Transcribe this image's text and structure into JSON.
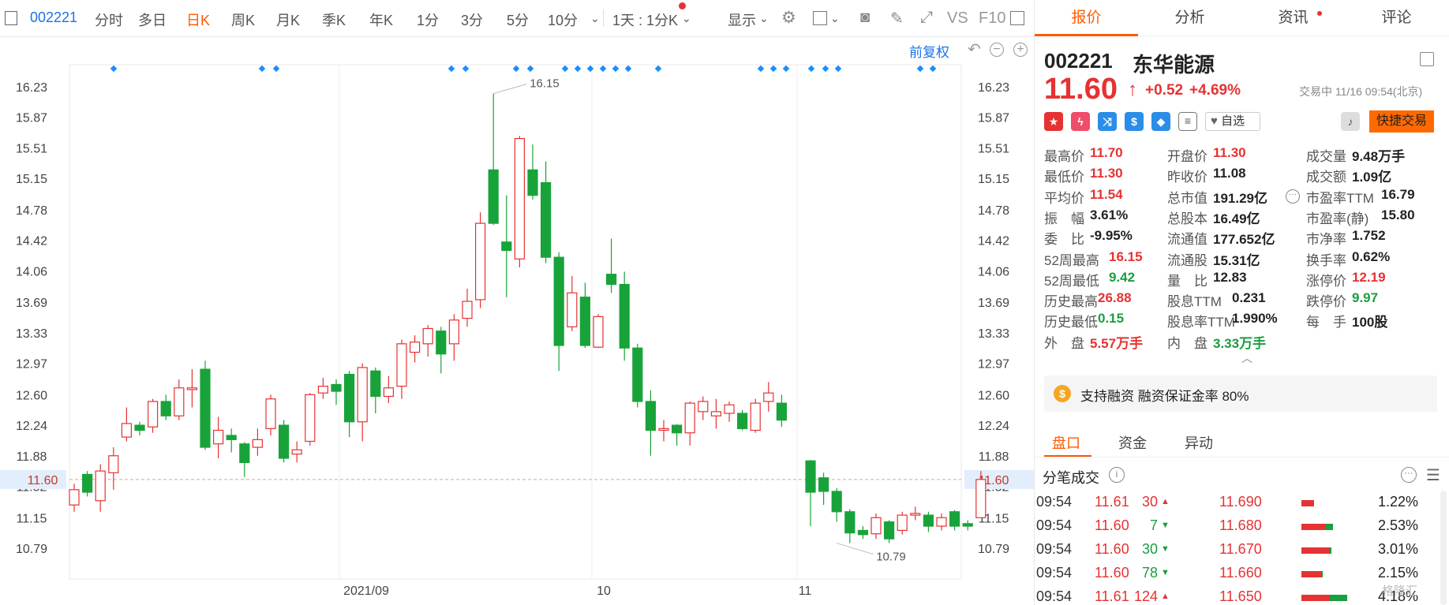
{
  "toolbar": {
    "code": "002221",
    "periods": [
      "分时",
      "多日",
      "日K",
      "周K",
      "月K",
      "季K",
      "年K",
      "1分",
      "3分",
      "5分",
      "10分"
    ],
    "active_period": "日K",
    "combo": "1天 : 1分K",
    "display": "显示",
    "vs_label": "VS",
    "f10_label": "F10"
  },
  "chart": {
    "adjust": "前复权",
    "price_labels": [
      "16.23",
      "15.87",
      "15.51",
      "15.15",
      "14.78",
      "14.42",
      "14.06",
      "13.69",
      "13.33",
      "12.97",
      "12.60",
      "12.24",
      "11.88",
      "11.52",
      "11.15",
      "10.79"
    ],
    "current_price_label": "11.60",
    "x_labels": [
      "2021/09",
      "10",
      "11"
    ],
    "high_annot": "16.15",
    "low_annot": "10.79"
  },
  "chart_data": {
    "type": "candlestick",
    "ylim": [
      10.55,
      16.4
    ],
    "y_ticks": [
      16.23,
      15.87,
      15.51,
      15.15,
      14.78,
      14.42,
      14.06,
      13.69,
      13.33,
      12.97,
      12.6,
      12.24,
      11.88,
      11.52,
      11.15,
      10.79
    ],
    "x_ticks": [
      "2021/09",
      "10",
      "11"
    ],
    "current_price": 11.6,
    "up_color": "#e63232",
    "down_color": "#18a33a",
    "candles": [
      {
        "o": 11.3,
        "c": 11.48,
        "h": 11.55,
        "l": 11.22
      },
      {
        "o": 11.66,
        "c": 11.45,
        "h": 11.7,
        "l": 11.4
      },
      {
        "o": 11.35,
        "c": 11.7,
        "h": 11.78,
        "l": 11.22
      },
      {
        "o": 11.68,
        "c": 11.88,
        "h": 11.98,
        "l": 11.48
      },
      {
        "o": 12.1,
        "c": 12.26,
        "h": 12.45,
        "l": 12.05
      },
      {
        "o": 12.24,
        "c": 12.18,
        "h": 12.28,
        "l": 12.12
      },
      {
        "o": 12.22,
        "c": 12.52,
        "h": 12.55,
        "l": 12.15
      },
      {
        "o": 12.52,
        "c": 12.35,
        "h": 12.6,
        "l": 12.3
      },
      {
        "o": 12.35,
        "c": 12.68,
        "h": 12.78,
        "l": 12.3
      },
      {
        "o": 12.66,
        "c": 12.68,
        "h": 12.9,
        "l": 12.45
      },
      {
        "o": 12.9,
        "c": 11.98,
        "h": 13.0,
        "l": 11.95
      },
      {
        "o": 12.02,
        "c": 12.18,
        "h": 12.34,
        "l": 11.85
      },
      {
        "o": 12.12,
        "c": 12.07,
        "h": 12.2,
        "l": 11.92
      },
      {
        "o": 12.02,
        "c": 11.8,
        "h": 12.04,
        "l": 11.63
      },
      {
        "o": 11.98,
        "c": 12.07,
        "h": 12.2,
        "l": 11.88
      },
      {
        "o": 12.2,
        "c": 12.55,
        "h": 12.6,
        "l": 12.12
      },
      {
        "o": 12.24,
        "c": 11.85,
        "h": 12.3,
        "l": 11.8
      },
      {
        "o": 11.9,
        "c": 11.95,
        "h": 12.05,
        "l": 11.8
      },
      {
        "o": 12.05,
        "c": 12.6,
        "h": 12.62,
        "l": 12.0
      },
      {
        "o": 12.62,
        "c": 12.7,
        "h": 12.8,
        "l": 12.55
      },
      {
        "o": 12.72,
        "c": 12.64,
        "h": 12.78,
        "l": 12.48
      },
      {
        "o": 12.84,
        "c": 12.28,
        "h": 12.88,
        "l": 12.1
      },
      {
        "o": 12.28,
        "c": 12.92,
        "h": 12.97,
        "l": 12.05
      },
      {
        "o": 12.88,
        "c": 12.58,
        "h": 12.92,
        "l": 12.38
      },
      {
        "o": 12.58,
        "c": 12.68,
        "h": 12.82,
        "l": 12.5
      },
      {
        "o": 12.7,
        "c": 13.2,
        "h": 13.25,
        "l": 12.55
      },
      {
        "o": 13.1,
        "c": 13.22,
        "h": 13.3,
        "l": 12.98
      },
      {
        "o": 13.2,
        "c": 13.38,
        "h": 13.42,
        "l": 13.05
      },
      {
        "o": 13.35,
        "c": 13.08,
        "h": 13.4,
        "l": 12.85
      },
      {
        "o": 13.2,
        "c": 13.48,
        "h": 13.55,
        "l": 13.0
      },
      {
        "o": 13.5,
        "c": 13.7,
        "h": 13.85,
        "l": 13.4
      },
      {
        "o": 13.72,
        "c": 14.62,
        "h": 14.75,
        "l": 13.62
      },
      {
        "o": 15.25,
        "c": 14.62,
        "h": 16.15,
        "l": 14.6
      },
      {
        "o": 14.4,
        "c": 14.3,
        "h": 14.95,
        "l": 13.75
      },
      {
        "o": 14.2,
        "c": 15.62,
        "h": 15.65,
        "l": 14.1
      },
      {
        "o": 15.25,
        "c": 14.95,
        "h": 15.55,
        "l": 14.9
      },
      {
        "o": 15.1,
        "c": 14.22,
        "h": 15.35,
        "l": 14.15
      },
      {
        "o": 14.22,
        "c": 13.18,
        "h": 14.28,
        "l": 12.88
      },
      {
        "o": 13.4,
        "c": 13.8,
        "h": 14.0,
        "l": 13.35
      },
      {
        "o": 13.75,
        "c": 13.18,
        "h": 13.92,
        "l": 13.15
      },
      {
        "o": 13.16,
        "c": 13.52,
        "h": 13.55,
        "l": 13.15
      },
      {
        "o": 14.02,
        "c": 13.9,
        "h": 14.44,
        "l": 13.8
      },
      {
        "o": 13.9,
        "c": 13.15,
        "h": 14.05,
        "l": 13.0
      },
      {
        "o": 13.15,
        "c": 12.52,
        "h": 13.2,
        "l": 12.45
      },
      {
        "o": 12.52,
        "c": 12.18,
        "h": 12.65,
        "l": 11.88
      },
      {
        "o": 12.18,
        "c": 12.2,
        "h": 12.3,
        "l": 12.05
      },
      {
        "o": 12.24,
        "c": 12.15,
        "h": 12.25,
        "l": 12.0
      },
      {
        "o": 12.15,
        "c": 12.5,
        "h": 12.52,
        "l": 12.0
      },
      {
        "o": 12.4,
        "c": 12.52,
        "h": 12.58,
        "l": 12.3
      },
      {
        "o": 12.35,
        "c": 12.4,
        "h": 12.55,
        "l": 12.2
      },
      {
        "o": 12.38,
        "c": 12.48,
        "h": 12.52,
        "l": 12.28
      },
      {
        "o": 12.38,
        "c": 12.2,
        "h": 12.42,
        "l": 12.18
      },
      {
        "o": 12.18,
        "c": 12.5,
        "h": 12.55,
        "l": 12.15
      },
      {
        "o": 12.52,
        "c": 12.62,
        "h": 12.75,
        "l": 12.4
      },
      {
        "o": 12.5,
        "c": 12.3,
        "h": 12.6,
        "l": 12.22
      },
      {
        "o": 11.82,
        "c": 11.45,
        "h": 11.83,
        "l": 11.05
      },
      {
        "o": 11.62,
        "c": 11.46,
        "h": 11.68,
        "l": 11.3
      },
      {
        "o": 11.46,
        "c": 11.22,
        "h": 11.5,
        "l": 11.1
      },
      {
        "o": 11.22,
        "c": 10.97,
        "h": 11.25,
        "l": 10.85
      },
      {
        "o": 11.0,
        "c": 10.95,
        "h": 11.05,
        "l": 10.9
      },
      {
        "o": 10.96,
        "c": 11.15,
        "h": 11.2,
        "l": 10.9
      },
      {
        "o": 11.1,
        "c": 10.9,
        "h": 11.12,
        "l": 10.85
      },
      {
        "o": 11.0,
        "c": 11.18,
        "h": 11.22,
        "l": 10.95
      },
      {
        "o": 11.18,
        "c": 11.2,
        "h": 11.28,
        "l": 11.12
      },
      {
        "o": 11.18,
        "c": 11.05,
        "h": 11.22,
        "l": 10.98
      },
      {
        "o": 11.05,
        "c": 11.15,
        "h": 11.2,
        "l": 11.0
      },
      {
        "o": 11.22,
        "c": 11.05,
        "h": 11.24,
        "l": 11.0
      },
      {
        "o": 11.08,
        "c": 11.05,
        "h": 11.12,
        "l": 11.0
      },
      {
        "o": 11.15,
        "c": 11.6,
        "h": 11.7,
        "l": 11.15
      }
    ]
  },
  "panel": {
    "tabs": [
      "报价",
      "分析",
      "资讯",
      "评论"
    ],
    "active_tab": "报价",
    "code": "002221",
    "name": "东华能源",
    "price": "11.60",
    "arrow": "↑",
    "change": "+0.52",
    "change_pct": "+4.69%",
    "status": "交易中 11/16 09:54(北京)",
    "watch_label": "自选",
    "quick_trade": "快捷交易",
    "icons": [
      "china-flag-icon",
      "bolt-icon",
      "shuffle-icon",
      "dollar-icon",
      "tag-icon",
      "document-icon"
    ],
    "stats": [
      [
        {
          "label": "最高价",
          "value": "11.70",
          "color": "up"
        },
        {
          "label": "开盘价",
          "value": "11.30",
          "color": "up"
        },
        {
          "label": "成交量",
          "value": "9.48万手",
          "color": "none"
        }
      ],
      [
        {
          "label": "最低价",
          "value": "11.30",
          "color": "up"
        },
        {
          "label": "昨收价",
          "value": "11.08",
          "color": "none"
        },
        {
          "label": "成交额",
          "value": "1.09亿",
          "color": "none"
        }
      ],
      [
        {
          "label": "平均价",
          "value": "11.54",
          "color": "up"
        },
        {
          "label": "总市值",
          "value": "191.29亿",
          "color": "none"
        },
        {
          "label": "市盈率TTM",
          "value": "16.79",
          "color": "none"
        }
      ],
      [
        {
          "label": "振　幅",
          "value": "3.61%",
          "color": "none"
        },
        {
          "label": "总股本",
          "value": "16.49亿",
          "color": "none"
        },
        {
          "label": "市盈率(静)",
          "value": "15.80",
          "color": "none"
        }
      ],
      [
        {
          "label": "委　比",
          "value": "-9.95%",
          "color": "none"
        },
        {
          "label": "流通值",
          "value": "177.652亿",
          "color": "none"
        },
        {
          "label": "市净率",
          "value": "1.752",
          "color": "none"
        }
      ],
      [
        {
          "label": "52周最高",
          "value": "16.15",
          "color": "up"
        },
        {
          "label": "流通股",
          "value": "15.31亿",
          "color": "none"
        },
        {
          "label": "换手率",
          "value": "0.62%",
          "color": "none"
        }
      ],
      [
        {
          "label": "52周最低",
          "value": "9.42",
          "color": "down"
        },
        {
          "label": "量　比",
          "value": "12.83",
          "color": "none"
        },
        {
          "label": "涨停价",
          "value": "12.19",
          "color": "up"
        }
      ],
      [
        {
          "label": "历史最高",
          "value": "26.88",
          "color": "up"
        },
        {
          "label": "股息TTM",
          "value": "0.231",
          "color": "none"
        },
        {
          "label": "跌停价",
          "value": "9.97",
          "color": "down"
        }
      ],
      [
        {
          "label": "历史最低",
          "value": "0.15",
          "color": "down"
        },
        {
          "label": "股息率TTM",
          "value": "1.990%",
          "color": "none"
        },
        {
          "label": "每　手",
          "value": "100股",
          "color": "none"
        }
      ],
      [
        {
          "label": "外　盘",
          "value": "5.57万手",
          "color": "up"
        },
        {
          "label": "内　盘",
          "value": "3.33万手",
          "color": "down"
        },
        {
          "label": "",
          "value": "",
          "color": "none"
        }
      ]
    ],
    "margin_text": "支持融资 融资保证金率 80%",
    "sub_tabs": [
      "盘口",
      "资金",
      "异动"
    ],
    "active_sub_tab": "盘口",
    "trades_title": "分笔成交",
    "trades": [
      {
        "time": "09:54",
        "price": "11.61",
        "vol": "30",
        "dir": "up",
        "ask": "11.690",
        "pct": "1.22%",
        "bar_red": 0.45,
        "bar_green": 0.0
      },
      {
        "time": "09:54",
        "price": "11.60",
        "vol": "7",
        "dir": "down",
        "ask": "11.680",
        "pct": "2.53%",
        "bar_red": 0.85,
        "bar_green": 0.25
      },
      {
        "time": "09:54",
        "price": "11.60",
        "vol": "30",
        "dir": "down",
        "ask": "11.670",
        "pct": "3.01%",
        "bar_red": 1.0,
        "bar_green": 0.05
      },
      {
        "time": "09:54",
        "price": "11.60",
        "vol": "78",
        "dir": "down",
        "ask": "11.660",
        "pct": "2.15%",
        "bar_red": 0.7,
        "bar_green": 0.05
      },
      {
        "time": "09:54",
        "price": "11.61",
        "vol": "124",
        "dir": "up",
        "ask": "11.650",
        "pct": "4.18%",
        "bar_red": 1.0,
        "bar_green": 0.6
      }
    ],
    "watermark": "格隆汇"
  }
}
